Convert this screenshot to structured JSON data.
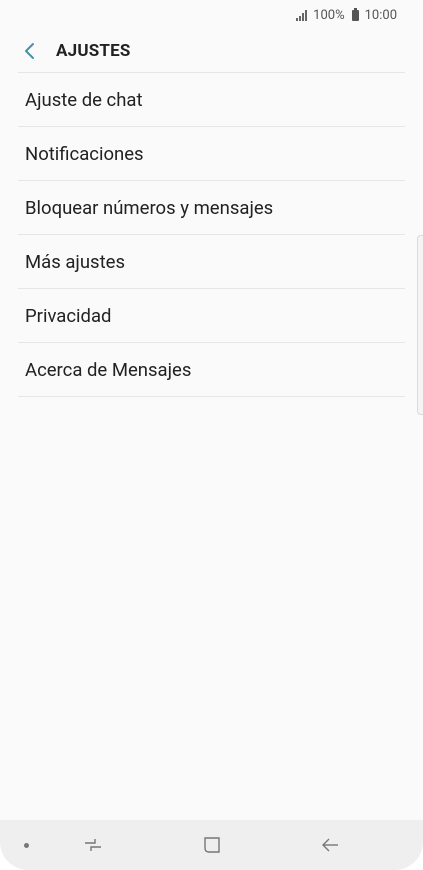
{
  "status_bar": {
    "battery": "100%",
    "time": "10:00"
  },
  "app_bar": {
    "title": "AJUSTES",
    "back_icon": "chevron-left-icon"
  },
  "settings": {
    "items": [
      {
        "label": "Ajuste de chat"
      },
      {
        "label": "Notificaciones"
      },
      {
        "label": "Bloquear números y mensajes"
      },
      {
        "label": "Más ajustes"
      },
      {
        "label": "Privacidad"
      },
      {
        "label": "Acerca de Mensajes"
      }
    ]
  },
  "nav_bar": {
    "icons": [
      "dot-icon",
      "recent-apps-icon",
      "home-icon",
      "back-arrow-icon"
    ]
  },
  "colors": {
    "accent": "#4a8fa8",
    "background": "#fafafa",
    "divider": "#e6e6e6",
    "text": "#222222"
  }
}
